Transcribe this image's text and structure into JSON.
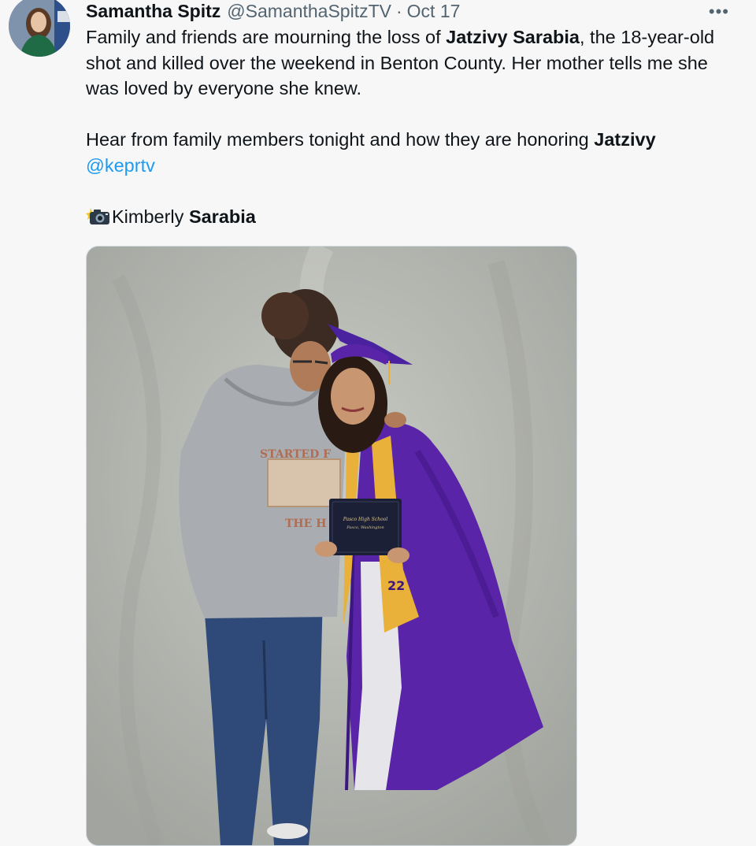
{
  "tweet": {
    "author_name": "Samantha Spitz",
    "author_handle": "@SamanthaSpitzTV",
    "separator": "·",
    "date": "Oct 17",
    "more_label": "•••",
    "paragraph1": {
      "part1": "Family and friends are mourning the loss of ",
      "bold1": "Jatzivy Sarabia",
      "part2": ", the 18-year-old shot and killed over the weekend in Benton County. Her mother tells me she was loved by everyone she knew."
    },
    "paragraph2": {
      "part1": "Hear from family members tonight and how they are honoring ",
      "bold1": "Jatzivy",
      "mention": "@keprtv"
    },
    "paragraph3": {
      "icon": "camera-flash-icon",
      "part1": "Kimberly ",
      "bold1": "Sarabia"
    },
    "photo": {
      "diploma_line1": "Pasco High School",
      "diploma_line2": "Pasco, Washington",
      "stole_number": "22",
      "hoodie_text1": "STARTED F",
      "hoodie_text2": "THE H"
    }
  },
  "colors": {
    "link": "#1d9bf0",
    "text": "#0f1419",
    "secondary": "#536471",
    "gown_purple": "#5a24a8",
    "stole_gold": "#e9b13a",
    "backdrop": "#b6b8b2"
  }
}
